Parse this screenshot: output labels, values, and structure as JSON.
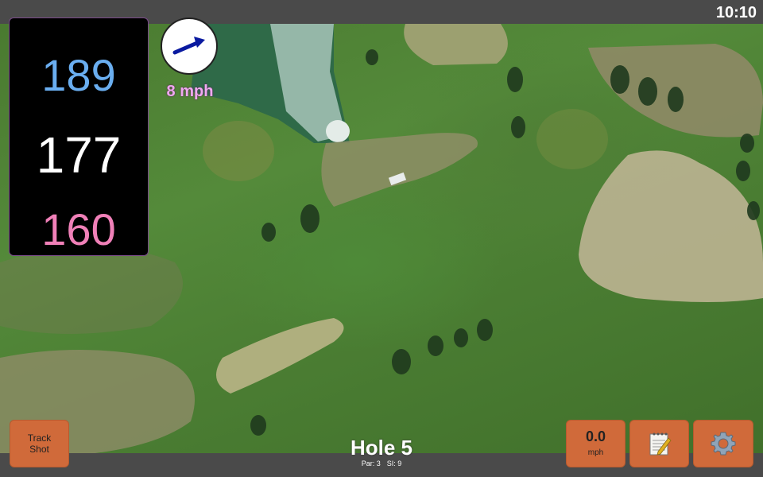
{
  "status": {
    "clock": "10:10"
  },
  "distances": {
    "back": "189",
    "middle": "177",
    "front": "160"
  },
  "wind": {
    "speed": "8 mph",
    "direction_icon": "wind-arrow-icon"
  },
  "buttons": {
    "track_shot_label": "Track\nShot",
    "speed_value": "0.0",
    "speed_unit": "mph",
    "notes_icon": "notepad-icon",
    "settings_icon": "gear-icon"
  },
  "hole": {
    "title": "Hole 5",
    "par": "Par: 3",
    "si": "SI: 9"
  },
  "colors": {
    "back_distance": "#6aaef0",
    "middle_distance": "#ffffff",
    "front_distance": "#f080b8",
    "button_bg": "#d06a3a",
    "wind_text": "#f0a8f0"
  }
}
